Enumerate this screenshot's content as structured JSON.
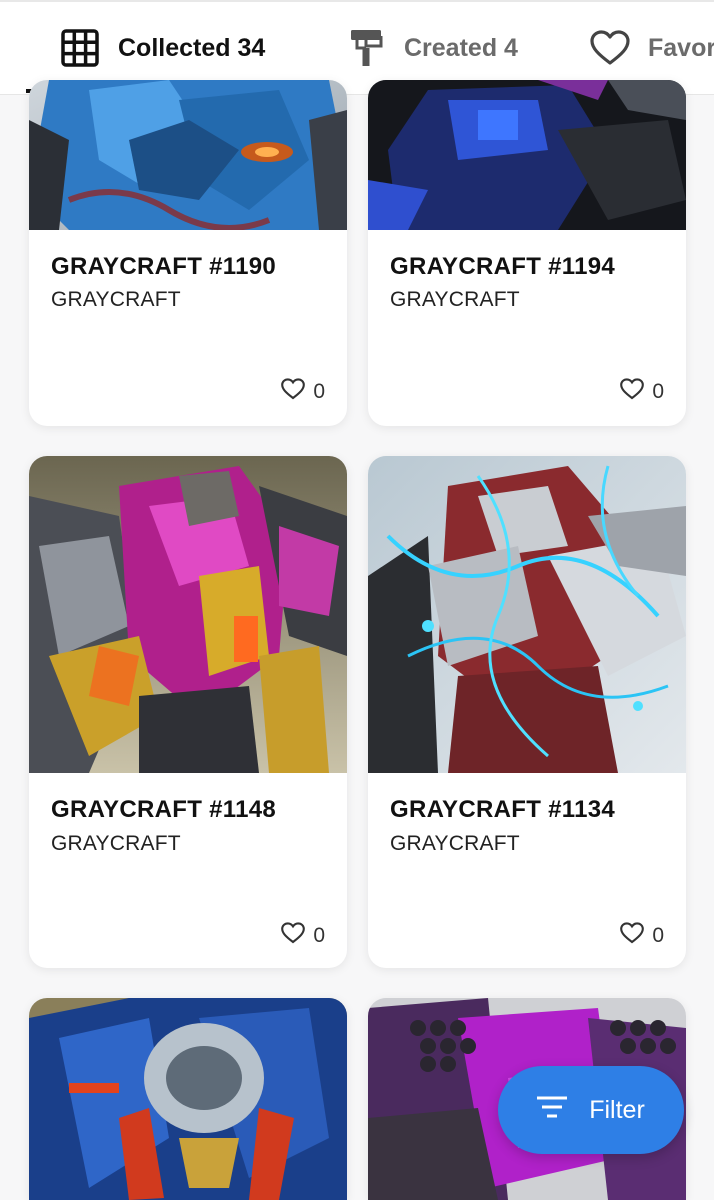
{
  "tabs": [
    {
      "label": "Collected 34",
      "icon": "grid-icon",
      "active": true
    },
    {
      "label": "Created 4",
      "icon": "paint-roller-icon",
      "active": false
    },
    {
      "label": "Favorites",
      "icon": "heart-icon",
      "active": false
    }
  ],
  "cards": [
    {
      "title": "GRAYCRAFT #1190",
      "collection": "GRAYCRAFT",
      "likes": "0",
      "palette": "blue-orange"
    },
    {
      "title": "GRAYCRAFT #1194",
      "collection": "GRAYCRAFT",
      "likes": "0",
      "palette": "blue-black"
    },
    {
      "title": "GRAYCRAFT #1148",
      "collection": "GRAYCRAFT",
      "likes": "0",
      "palette": "magenta-gold"
    },
    {
      "title": "GRAYCRAFT #1134",
      "collection": "GRAYCRAFT",
      "likes": "0",
      "palette": "cyan-red"
    },
    {
      "title": "",
      "collection": "",
      "likes": "",
      "palette": "blue-red"
    },
    {
      "title": "",
      "collection": "",
      "likes": "",
      "palette": "purple"
    }
  ],
  "filter": {
    "label": "Filter",
    "icon": "filter-lines-icon"
  },
  "colors": {
    "accent": "#2e7fe6",
    "card_bg": "#ffffff",
    "page_bg": "#f7f7f8"
  }
}
